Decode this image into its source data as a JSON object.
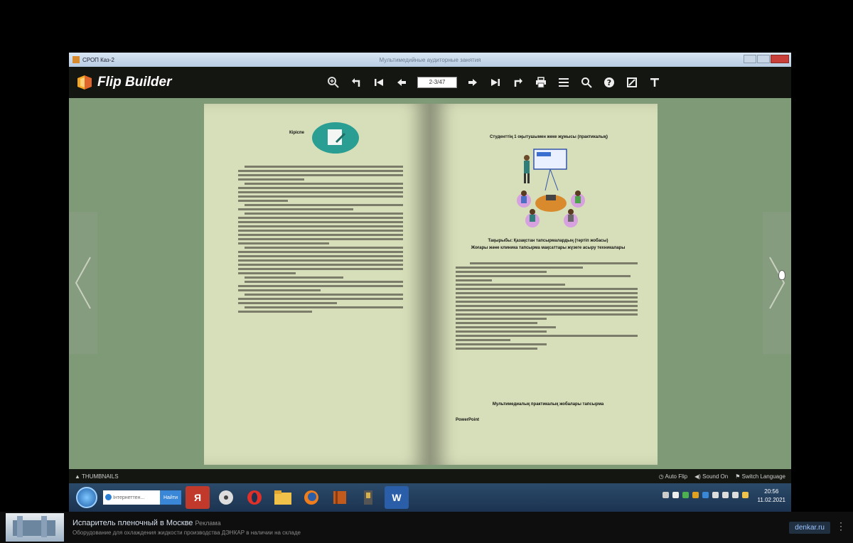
{
  "window": {
    "tab_title": "СРОП Каз-2",
    "center_title": "Мультимедийные аудиторные занятия"
  },
  "toolbar": {
    "logo_text": "Flip Builder",
    "page_indicator": "2-3/47",
    "icons": [
      "zoom-in-icon",
      "back-icon",
      "first-page-icon",
      "prev-page-icon",
      "next-page-icon",
      "last-page-icon",
      "forward-icon",
      "print-icon",
      "contents-icon",
      "search-icon",
      "help-icon",
      "fullscreen-icon",
      "text-icon"
    ]
  },
  "book": {
    "left_heading": "Кіріспе",
    "right_heading": "Студенттің 1 оқытушымен жеке жұмысы (практикалық)",
    "right_section_title": "Тақырыбы: Қазақстан тапсырмалардың (тәртіп жобасы)",
    "right_section_subtitle": "Жоғары және клиника тапсырма мақсаттары жүзеге асыру техникалары",
    "right_list_title": "Мультимедиалық практикалық жобалары тапсырма",
    "right_footer": "PowerPoint"
  },
  "bottom_bar": {
    "thumbnails_label": "THUMBNAILS",
    "auto_flip": "Auto Flip",
    "sound": "Sound On",
    "switch_language": "Switch Language"
  },
  "taskbar": {
    "search_placeholder": "Інтернеттен...",
    "search_button": "Найти",
    "clock_time": "20:56",
    "clock_date": "11.02.2021"
  },
  "ad": {
    "title": "Испаритель пленочный в Москве",
    "badge": "Реклама",
    "description": "Оборудование для охлаждения жидкости производства ДЭНКАР в наличии на складе",
    "domain": "denkar.ru",
    "menu_glyph": "⋮"
  },
  "colors": {
    "stage_bg": "#7f9a77",
    "page_bg": "#d7dfba",
    "toolbar_bg": "#141611",
    "accent_teal": "#2a9e93"
  }
}
